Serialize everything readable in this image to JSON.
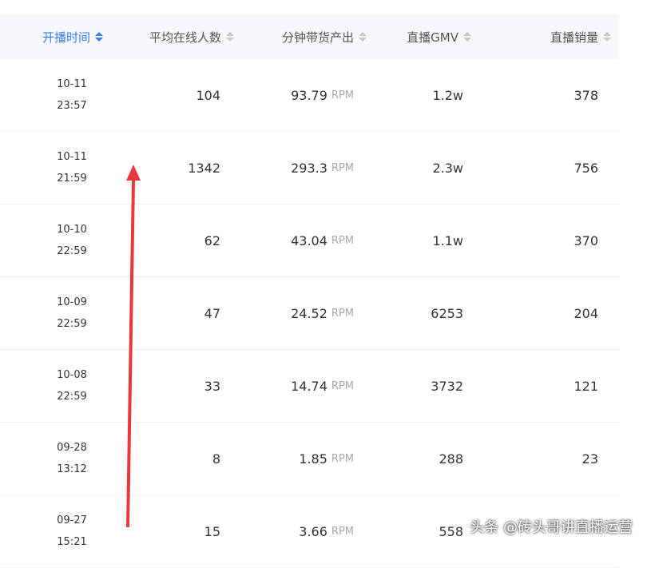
{
  "table": {
    "headers": [
      {
        "label": "开播时间",
        "sort": "active"
      },
      {
        "label": "平均在线人数",
        "sort": "none"
      },
      {
        "label": "分钟带货产出",
        "sort": "none"
      },
      {
        "label": "直播GMV",
        "sort": "none"
      },
      {
        "label": "直播销量",
        "sort": "none"
      }
    ],
    "rows": [
      {
        "date": "10-11",
        "time": "23:57",
        "avg_online": "104",
        "rpm": "93.79",
        "rpm_unit": "RPM",
        "gmv": "1.2w",
        "sales": "378"
      },
      {
        "date": "10-11",
        "time": "21:59",
        "avg_online": "1342",
        "rpm": "293.3",
        "rpm_unit": "RPM",
        "gmv": "2.3w",
        "sales": "756"
      },
      {
        "date": "10-10",
        "time": "22:59",
        "avg_online": "62",
        "rpm": "43.04",
        "rpm_unit": "RPM",
        "gmv": "1.1w",
        "sales": "370"
      },
      {
        "date": "10-09",
        "time": "22:59",
        "avg_online": "47",
        "rpm": "24.52",
        "rpm_unit": "RPM",
        "gmv": "6253",
        "sales": "204"
      },
      {
        "date": "10-08",
        "time": "22:59",
        "avg_online": "33",
        "rpm": "14.74",
        "rpm_unit": "RPM",
        "gmv": "3732",
        "sales": "121"
      },
      {
        "date": "09-28",
        "time": "13:12",
        "avg_online": "8",
        "rpm": "1.85",
        "rpm_unit": "RPM",
        "gmv": "288",
        "sales": "23"
      },
      {
        "date": "09-27",
        "time": "15:21",
        "avg_online": "15",
        "rpm": "3.66",
        "rpm_unit": "RPM",
        "gmv": "558",
        "sales": ""
      }
    ]
  },
  "annotation": {
    "arrow_color": "#e8383d"
  },
  "watermark": "头条 @砖头哥讲直播运营",
  "colors": {
    "accent": "#3b7df5",
    "header_bg": "#f5f7fa",
    "unit_gray": "#a8a8a8"
  }
}
